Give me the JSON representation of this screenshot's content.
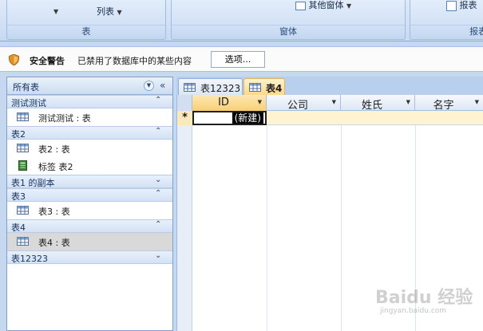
{
  "ribbon": {
    "group_table_label": "表",
    "group_window_label": "窗体",
    "group_report_label": "报表",
    "list_label": "列表",
    "other_form_label": "其他窗体",
    "report_label": "报表"
  },
  "security": {
    "title": "安全警告",
    "message": "已禁用了数据库中的某些内容",
    "options_button": "选项..."
  },
  "nav": {
    "header": "所有表",
    "groups": [
      {
        "label": "测试测试",
        "items": [
          {
            "label": "测试测试 : 表",
            "icon": "table-icon"
          }
        ]
      },
      {
        "label": "表2",
        "items": [
          {
            "label": "表2 : 表",
            "icon": "table-icon"
          },
          {
            "label": "标签 表2",
            "icon": "report-icon"
          }
        ]
      },
      {
        "label": "表1 的副本",
        "items": []
      },
      {
        "label": "表3",
        "items": [
          {
            "label": "表3 : 表",
            "icon": "table-icon"
          }
        ]
      },
      {
        "label": "表4",
        "items": [
          {
            "label": "表4 : 表",
            "icon": "table-icon",
            "selected": true
          }
        ]
      },
      {
        "label": "表12323",
        "items": []
      }
    ]
  },
  "doc_tabs": [
    {
      "label": "表12323",
      "active": false
    },
    {
      "label": "表4",
      "active": true
    }
  ],
  "sheet": {
    "columns": [
      "ID",
      "公司",
      "姓氏",
      "名字"
    ],
    "new_row_marker": "*",
    "new_row_text": "(新建)"
  },
  "watermark": {
    "brand": "Baidu 经验",
    "url": "jingyan.baidu.com"
  },
  "colors": {
    "accent": "#fcd98a",
    "ribbon_bg": "#d3e2f6",
    "selected_item": "#d9d9d9"
  }
}
